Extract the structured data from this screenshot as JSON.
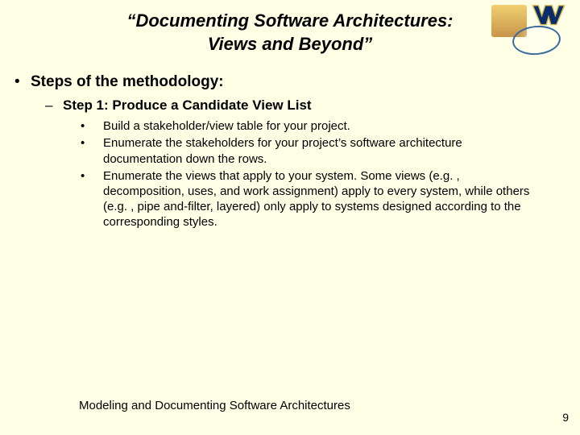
{
  "title": "“Documenting Software Architectures: Views and Beyond”",
  "heading": "Steps of the methodology:",
  "step_title": "Step 1: Produce a Candidate View List",
  "sub_bullets": [
    "Build a stakeholder/view table for your project.",
    "Enumerate the stakeholders for your project’s software architecture documentation down the rows.",
    "Enumerate the views that apply to your system. Some views (e.g. , decomposition, uses, and work assignment) apply to every system, while others (e.g. , pipe and-filter, layered) only apply to systems designed according to the corresponding styles."
  ],
  "footer": "Modeling and Documenting Software Architectures",
  "page_number": "9"
}
